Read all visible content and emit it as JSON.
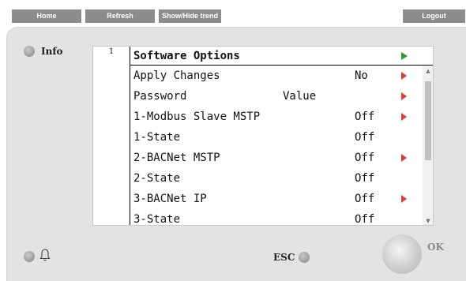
{
  "toolbar": {
    "home_label": "Home",
    "refresh_label": "Refresh",
    "trend_label": "Show/Hide trend",
    "logout_label": "Logout"
  },
  "info_label": "Info",
  "esc_label": "ESC",
  "ok_label": "OK",
  "screen": {
    "page_number": "1",
    "title": "Software Options",
    "rows": [
      {
        "label": "Apply Changes",
        "value": "No",
        "has_arrow": true
      },
      {
        "label": "Password",
        "value": "Value",
        "has_arrow": true
      },
      {
        "label": "1-Modbus Slave MSTP",
        "value": "Off",
        "has_arrow": true
      },
      {
        "label": "1-State",
        "value": "Off",
        "has_arrow": false
      },
      {
        "label": "2-BACNet MSTP",
        "value": "Off",
        "has_arrow": true
      },
      {
        "label": "2-State",
        "value": "Off",
        "has_arrow": false
      },
      {
        "label": "3-BACNet IP",
        "value": "Off",
        "has_arrow": true
      },
      {
        "label": "3-State",
        "value": "Off",
        "has_arrow": false
      }
    ]
  },
  "colors": {
    "toolbar_button": "#8c8c8c",
    "panel_background": "#e3e3e3",
    "arrow_red": "#e53935",
    "title_arrow_green": "#2e9e2e"
  },
  "icons": {
    "bell": "bell-icon",
    "title_arrow": "play-right-icon",
    "row_arrow": "play-right-icon"
  }
}
